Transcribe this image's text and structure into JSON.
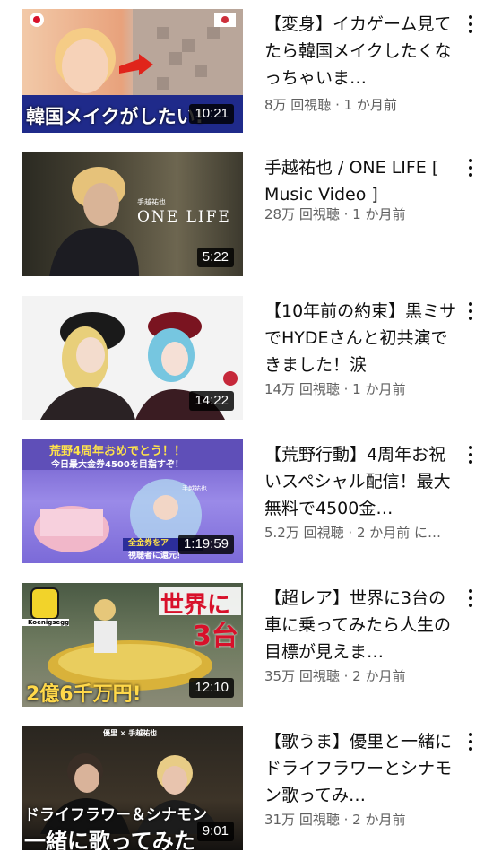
{
  "videos": [
    {
      "title": "【変身】イカゲーム見てたら韓国メイクしたくなっちゃいま…",
      "views": "8万 回視聴",
      "age": "1 か月前",
      "duration": "10:21",
      "thumb_caption": "韓国メイクがしたい!"
    },
    {
      "title": "手越祐也 / ONE LIFE [ Music Video ]",
      "views": "28万 回視聴",
      "age": "1 か月前",
      "duration": "5:22",
      "thumb_caption": "ONE LIFE",
      "thumb_small": "手越祐也"
    },
    {
      "title": "【10年前の約束】黒ミサでHYDEさんと初共演できました！涙",
      "views": "14万 回視聴",
      "age": "1 か月前",
      "duration": "14:22"
    },
    {
      "title": "【荒野行動】4周年お祝いスペシャル配信！最大無料で4500金…",
      "views": "5.2万 回視聴",
      "age": "2 か月前 に…",
      "duration": "1:19:59",
      "thumb_caption": "荒野4周年おめでとう！！",
      "thumb_caption2": "今日最大金券4500を目指すぞ！",
      "thumb_caption3": "全金券をア",
      "thumb_caption4": "視聴者に還元！",
      "thumb_small": "手越祐也"
    },
    {
      "title": "【超レア】世界に3台の車に乗ってみたら人生の目標が見えま…",
      "views": "35万 回視聴",
      "age": "2 か月前",
      "duration": "12:10",
      "thumb_caption": "世界に",
      "thumb_caption2": "3台",
      "thumb_caption3": "2億6千万円!",
      "thumb_small": "Koenigsegg"
    },
    {
      "title": "【歌うま】優里と一緒にドライフラワーとシナモン歌ってみ…",
      "views": "31万 回視聴",
      "age": "2 か月前",
      "duration": "9:01",
      "thumb_caption": "ドライフラワー＆シナモン",
      "thumb_caption2": "一緒に歌ってみた",
      "thumb_small": "優里 × 手越祐也"
    }
  ],
  "separator": " · ",
  "icons": {
    "more": "more-vert-icon"
  },
  "colors": {
    "meta": "#606060",
    "title": "#0f0f0f"
  }
}
